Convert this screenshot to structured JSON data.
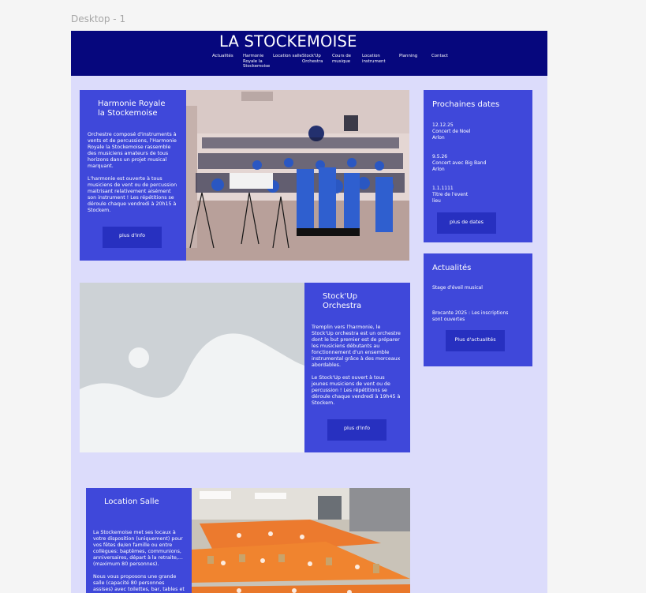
{
  "canvas": {
    "frame_label": "Desktop - 1"
  },
  "header": {
    "title": "LA STOCKEMOISE",
    "nav": [
      {
        "label": "Actualités"
      },
      {
        "label": "Harmonie\nRoyale la\nStockemoise"
      },
      {
        "label": "Location salle"
      },
      {
        "label": "Stock'Up\nOrchestra"
      },
      {
        "label": "Cours de\nmusique"
      },
      {
        "label": "Location\ninstrument"
      },
      {
        "label": "Planning"
      },
      {
        "label": "Contact"
      }
    ]
  },
  "harmonie": {
    "title": "Harmonie Royale\nla Stockemoise",
    "text": "Orchestre composé d'instruments à\nvents et de percussions, l'Harmonie\nRoyale la Stockemoise rassemble\ndes musiciens amateurs de tous\nhorizons dans un projet musical\nmarquant.\n\nL'harmonie est ouverte à tous\nmusiciens de vent ou de percussion\nmaitrisant relativement aisément\nson instrument ! Les répétitions se\ndéroule chaque vendredi à 20h15 à\nStockem.",
    "button": "plus d'info"
  },
  "stockup": {
    "title": "Stock'Up\nOrchestra",
    "text": "Tremplin vers l'harmonie, le\nStock'Up orchestra est un orchestre\ndont le but premier est de préparer\nles musiciens débutants au\nfonctionnement d'un ensemble\ninstrumental grâce à des morceaux\nabordables.\n\nLe Stock'Up est ouvert à tous\njeunes musiciens de vent ou de\npercussion ! Les répétitions se\ndéroule chaque vendredi à 19h45 à\nStockem.",
    "button": "plus d'info"
  },
  "location": {
    "title": "Location Salle",
    "text": "La Stockemoise met ses locaux à\nvotre disposition (uniquement) pour\nvos fêtes de/en famille ou entre\ncollègues: baptêmes, communions,\nanniversaires, départ à la retraite,...\n(maximum 80 personnes).\n\nNous vous proposons une grande\nsalle (capacité 80 personnes\nassises) avec toilettes, bar, tables et"
  },
  "dates": {
    "title": "Prochaines dates",
    "events": [
      {
        "text": "12.12.25\nConcert de Noel\nArlon"
      },
      {
        "text": "9.5.26\nConcert avec Big Band\nArlon"
      },
      {
        "text": "1.1.1111\nTitre de l'event\nlieu"
      }
    ],
    "button": "plus de dates"
  },
  "news": {
    "title": "Actualités",
    "items": [
      {
        "text": "Stage d'éveil musical"
      },
      {
        "text": "Brocante 2025 : Les inscriptions\nsont ouvertes"
      }
    ],
    "button": "Plus d'actualités"
  },
  "colors": {
    "header": "#06077d",
    "card": "#3f48da",
    "button": "#2730c0",
    "background": "#dcdcfb"
  }
}
